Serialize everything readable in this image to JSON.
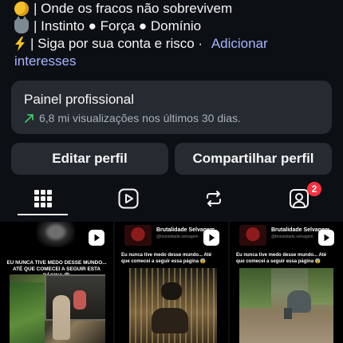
{
  "bio": {
    "line1": "| Onde os fracos não sobrevivem",
    "line2": "| Instinto ● Força ● Domínio",
    "line3_text": "| Siga por sua conta e risco · ",
    "line3_link": "Adicionar",
    "line4_link": "interesses",
    "icons": [
      "moon-emoji-icon",
      "wolf-emoji-icon",
      "lightning-emoji-icon"
    ]
  },
  "professional_panel": {
    "title": "Painel profissional",
    "stats": "6,8 mi visualizações nos últimos 30 dias.",
    "trend_icon": "trend-up-arrow-icon"
  },
  "buttons": {
    "edit": "Editar perfil",
    "share": "Compartilhar perfil"
  },
  "tabs": [
    {
      "icon": "grid-icon",
      "active": true
    },
    {
      "icon": "reels-icon",
      "active": false
    },
    {
      "icon": "reposts-icon",
      "active": false
    },
    {
      "icon": "tagged-icon",
      "active": false,
      "badge": "2"
    }
  ],
  "posts": [
    {
      "caption": "EU NUNCA TIVE MEDO DESSE MUNDO... ATÉ QUE COMECEI A SEGUIR ESTA PÁGINA 😨",
      "type_icon": "reel-icon"
    },
    {
      "account": "Brutalidade Selvagem",
      "handle": "@brutalidade.selvagem",
      "logo_text": "BRUTALIDADE SELVAGEM",
      "caption": "Eu nunca tive medo desse mundo... Até que comecei a seguir essa página 😨",
      "type_icon": "reel-icon"
    },
    {
      "account": "Brutalidade Selvagem",
      "handle": "@brutalidade.selvagem",
      "logo_text": "BRUTALIDADE SELVAGEM",
      "caption": "Eu nunca tive medo desse mundo... Até que comecei a seguir essa página 😨",
      "type_icon": "reel-icon"
    }
  ],
  "colors": {
    "background": "#0c1014",
    "card": "#262a31",
    "link": "#a8b4ff",
    "trend": "#3cc86a",
    "badge": "#ff3040"
  }
}
